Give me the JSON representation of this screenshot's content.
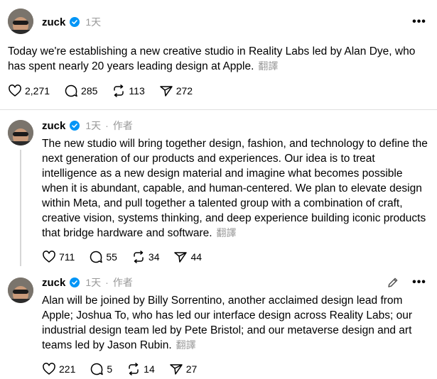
{
  "post1": {
    "username": "zuck",
    "time": "1天",
    "text": "Today we're establishing a new creative studio in Reality Labs led by Alan Dye, who has spent nearly 20 years leading design at Apple.",
    "translate": "翻譯",
    "likes": "2,271",
    "comments": "285",
    "reposts": "113",
    "shares": "272"
  },
  "post2": {
    "username": "zuck",
    "time": "1天",
    "author_tag": "作者",
    "text": "The new studio will bring together design, fashion, and technology to define the next generation of our products and experiences. Our idea is to treat intelligence as a new design material and imagine what becomes possible when it is abundant, capable, and human-centered. We plan to elevate design within Meta, and pull together a talented group with a combination of craft, creative vision, systems thinking, and deep experience building iconic products that bridge hardware and software.",
    "translate": "翻譯",
    "likes": "711",
    "comments": "55",
    "reposts": "34",
    "shares": "44"
  },
  "post3": {
    "username": "zuck",
    "time": "1天",
    "author_tag": "作者",
    "text": "Alan will be joined by Billy Sorrentino, another acclaimed design lead from Apple; Joshua To, who has led our interface design across Reality Labs; our industrial design team led by Pete Bristol; and our metaverse design and art teams led by Jason Rubin.",
    "translate": "翻譯",
    "likes": "221",
    "comments": "5",
    "reposts": "14",
    "shares": "27"
  },
  "colors": {
    "verified": "#0095f6",
    "muted": "#999999",
    "divider": "#e0e0e0"
  },
  "icons": [
    "verified-icon",
    "more-icon",
    "edit-icon",
    "heart-icon",
    "comment-icon",
    "repost-icon",
    "share-icon"
  ]
}
